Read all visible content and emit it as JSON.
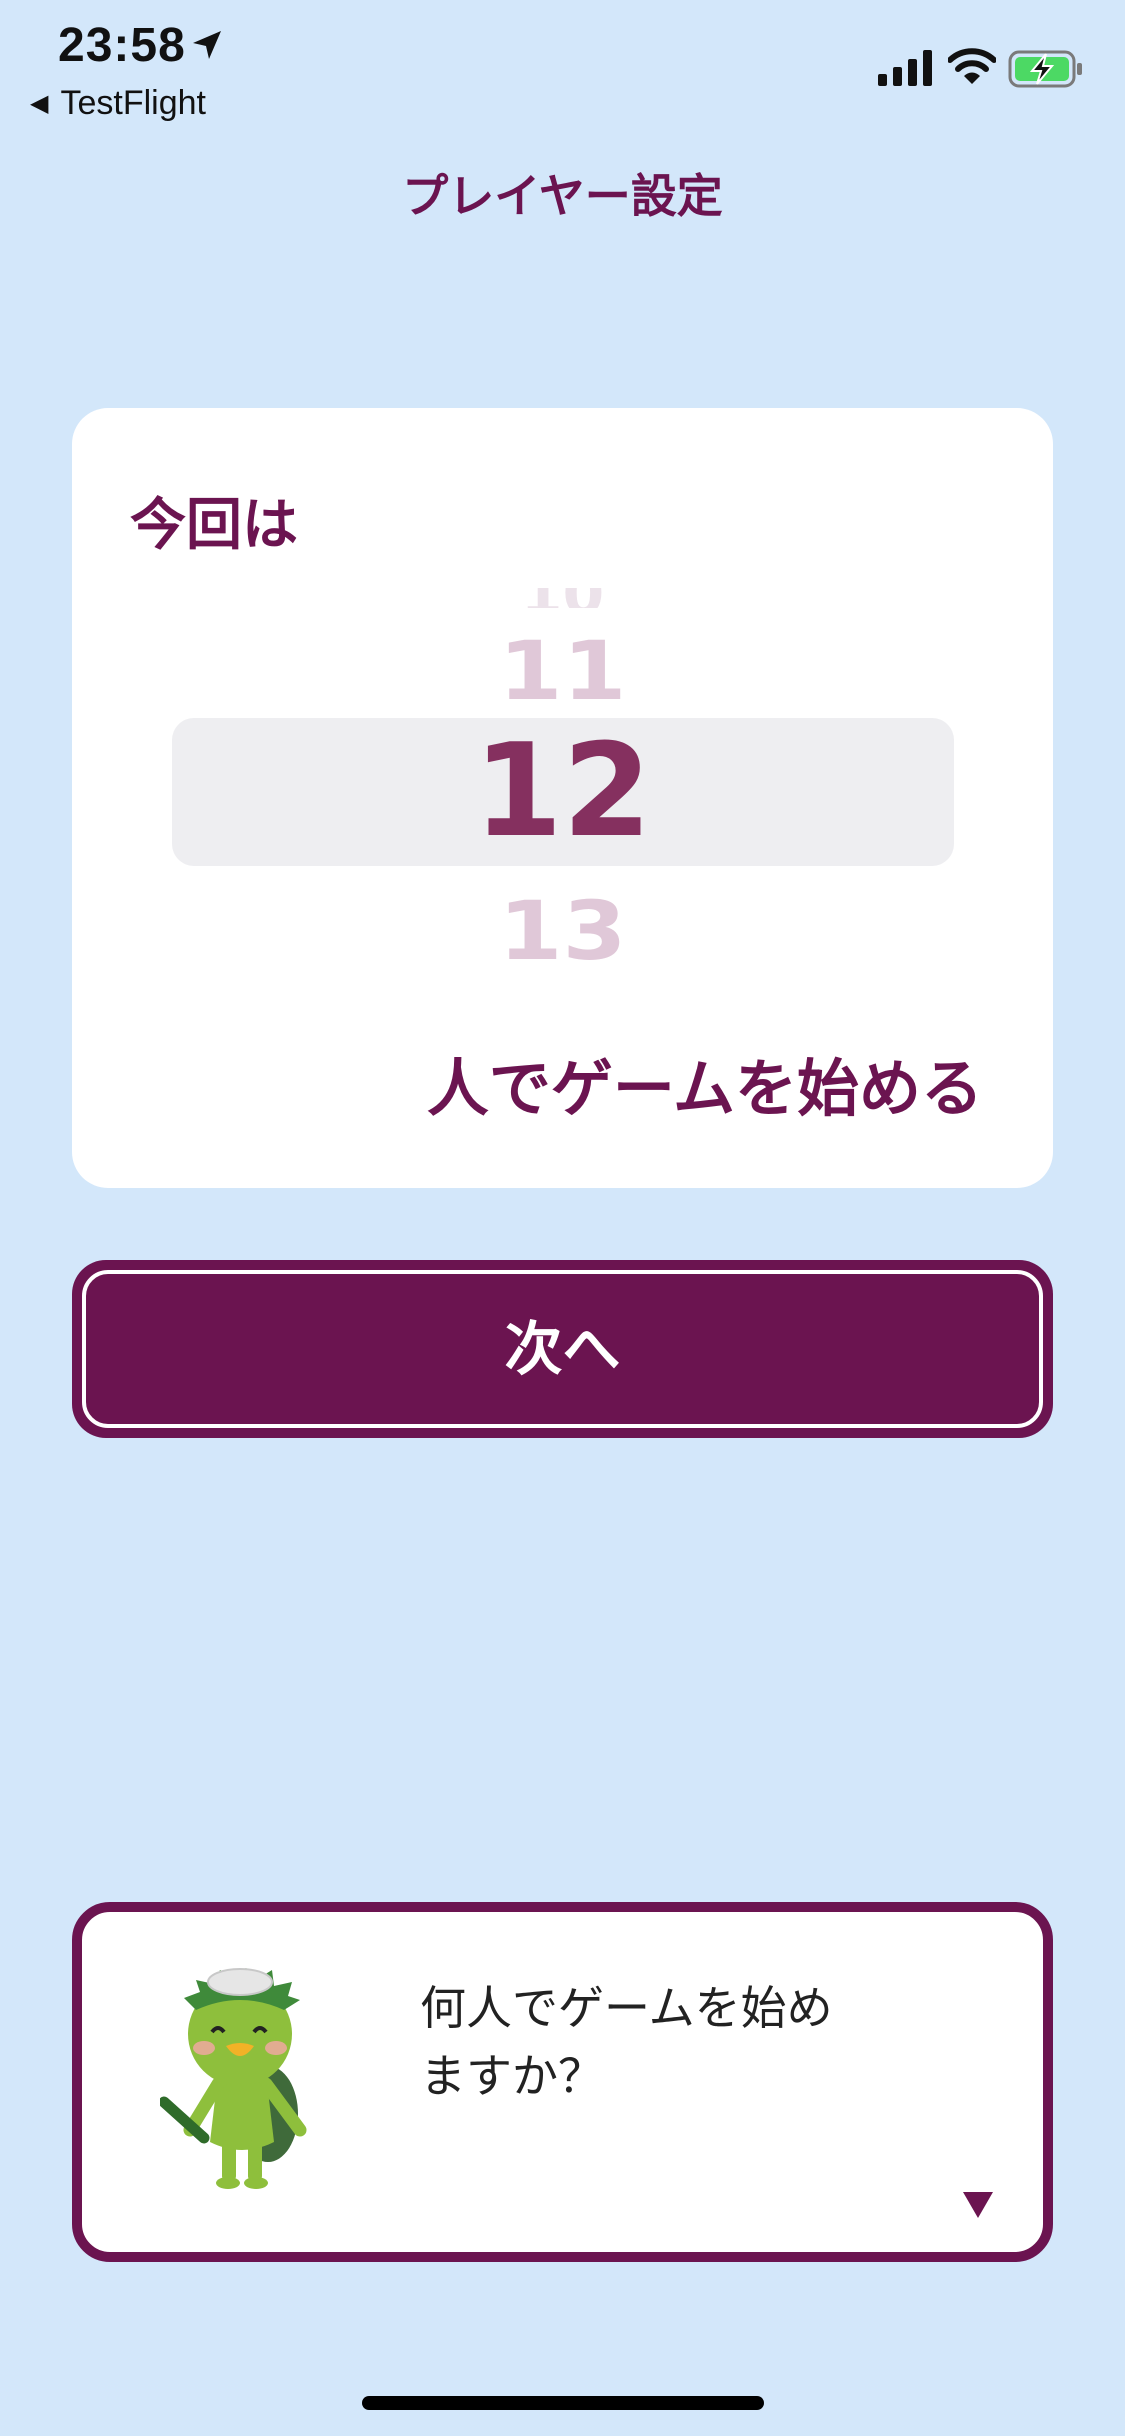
{
  "status_bar": {
    "time": "23:58",
    "back_app": "TestFlight",
    "icons": [
      "location-arrow-icon",
      "signal-icon",
      "wifi-icon",
      "battery-charging-icon"
    ]
  },
  "nav": {
    "title": "プレイヤー設定"
  },
  "player_card": {
    "lead": "今回は",
    "picker": {
      "options_visible": [
        "11",
        "12",
        "13"
      ],
      "selected": "12"
    },
    "tail": "人でゲームを始める"
  },
  "next_button": {
    "label": "次へ"
  },
  "dialog": {
    "text": "何人でゲームを始め\nますか？",
    "character": "kappa-mascot",
    "indicator": "triangle-down-icon"
  },
  "colors": {
    "background": "#d3e7fa",
    "accent": "#6b1450",
    "card": "#ffffff",
    "picker_band": "#eeeef1"
  }
}
